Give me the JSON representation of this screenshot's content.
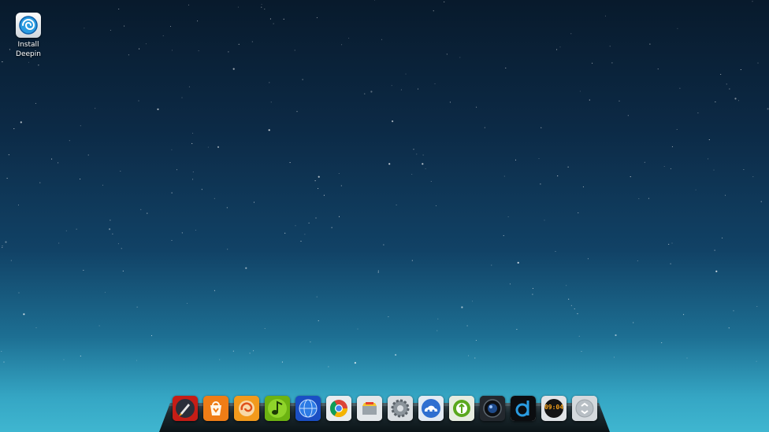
{
  "desktop": {
    "icons": [
      {
        "label": "Install Deepin",
        "icon": "deepin-installer-icon"
      }
    ]
  },
  "dock": {
    "apps": [
      {
        "name": "launcher",
        "icon": "rocket-icon",
        "color": "#d9261c"
      },
      {
        "name": "store",
        "icon": "shopping-bag-icon",
        "color": "#f0801a"
      },
      {
        "name": "media-player",
        "icon": "film-reel-icon",
        "color": "#f5a623"
      },
      {
        "name": "music",
        "icon": "music-note-icon",
        "color": "#7cc11a"
      },
      {
        "name": "browser",
        "icon": "globe-icon",
        "color": "#1e63d6"
      },
      {
        "name": "chrome",
        "icon": "chrome-icon",
        "color": "#e8ecef"
      },
      {
        "name": "file-manager",
        "icon": "folder-drawer-icon",
        "color": "#e8ecef"
      },
      {
        "name": "settings",
        "icon": "gear-icon",
        "color": "#dfe4e8"
      },
      {
        "name": "network",
        "icon": "cloud-people-icon",
        "color": "#dfe8f2"
      },
      {
        "name": "ideas",
        "icon": "leaf-bulb-icon",
        "color": "#e8f0e0"
      },
      {
        "name": "camera",
        "icon": "camera-lens-icon",
        "color": "#1b1f24"
      },
      {
        "name": "deepin-music",
        "icon": "d-logo-icon",
        "color": "#f0f2f4"
      },
      {
        "name": "clock",
        "icon": "clock-icon",
        "color": "#141414",
        "time": "09:04"
      },
      {
        "name": "trash",
        "icon": "trash-icon",
        "color": "#d8dde1"
      }
    ]
  }
}
